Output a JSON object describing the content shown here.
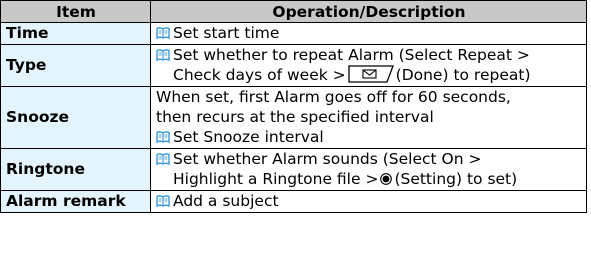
{
  "table": {
    "headers": [
      "Item",
      "Operation/Description"
    ],
    "rows": [
      {
        "item": "Time",
        "desc": "Set start time"
      },
      {
        "item": "Type",
        "desc_line1": "Set whether to repeat Alarm (Select Repeat >",
        "desc_line2_pre": "Check days of week >",
        "desc_line2_post": "(Done) to repeat)"
      },
      {
        "item": "Snooze",
        "desc_line1": "When set, first Alarm goes off for 60 seconds,",
        "desc_line2": "then recurs at the specified interval",
        "desc_line3": "Set Snooze interval"
      },
      {
        "item": "Ringtone",
        "desc_line1": "Set whether Alarm sounds (Select On >",
        "desc_line2_pre": "Highlight a Ringtone file >",
        "desc_line2_post": "(Setting) to set)"
      },
      {
        "item": "Alarm remark",
        "desc": "Add a subject"
      }
    ]
  },
  "icons": {
    "reference": "book-icon",
    "done_key": "mail-softkey-icon",
    "setting_key": "center-key-icon"
  },
  "colors": {
    "header_bg": "#c8c8c8",
    "item_bg": "#e4f4fc",
    "book_icon": "#3a9ad9"
  }
}
